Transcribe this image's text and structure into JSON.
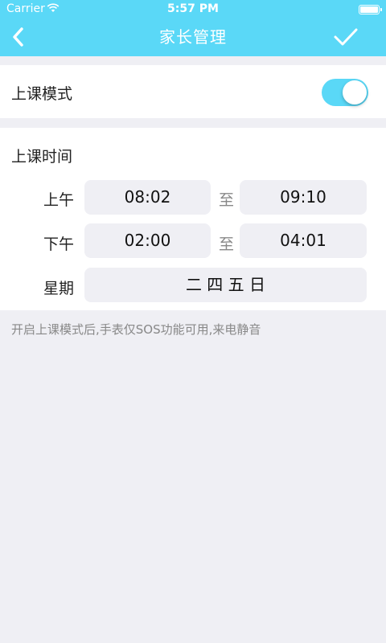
{
  "status_bar": {
    "carrier": "Carrier",
    "time": "5:57 PM"
  },
  "nav": {
    "title": "家长管理",
    "back_icon": "chevron-left-icon",
    "confirm_icon": "check-icon"
  },
  "class_mode": {
    "label": "上课模式",
    "enabled": true,
    "accent_color": "#5ad8f7"
  },
  "class_time": {
    "heading": "上课时间",
    "to_label": "至",
    "morning": {
      "label": "上午",
      "start": "08:02",
      "end": "09:10"
    },
    "afternoon": {
      "label": "下午",
      "start": "02:00",
      "end": "04:01"
    },
    "weekdays": {
      "label": "星期",
      "value": "二 四 五 日"
    }
  },
  "hint_text": "开启上课模式后,手表仅SOS功能可用,来电静音"
}
